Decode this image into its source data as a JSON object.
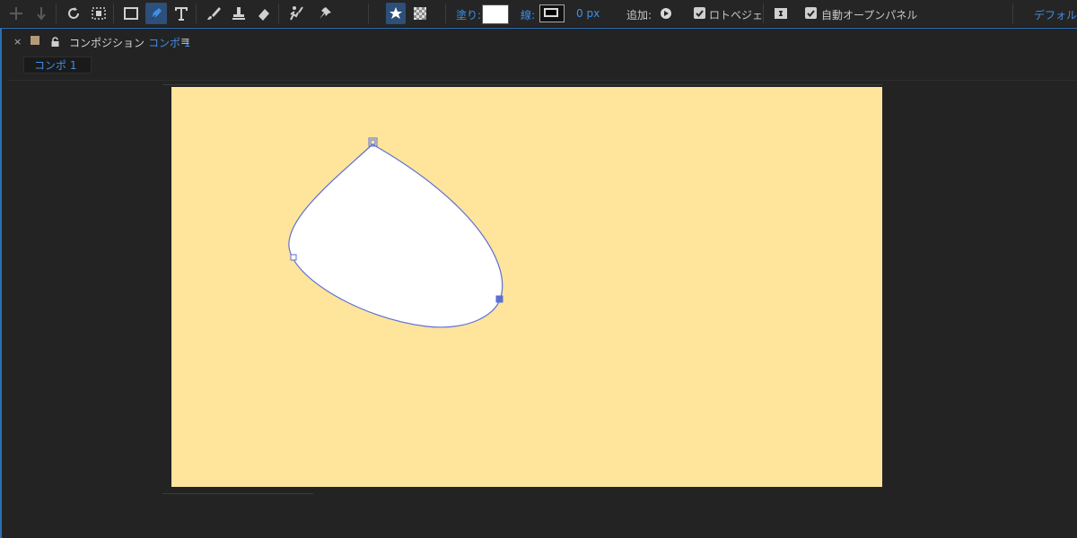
{
  "toolbar": {
    "fill_label": "塗り:",
    "stroke_label": "線:",
    "stroke_width": "0 px",
    "add_label": "追加:",
    "rotobezier_label": "ロトベジェ",
    "auto_open_panel_label": "自動オープンパネル",
    "workspace_label": "デフォルト",
    "rotobezier_checked": true,
    "auto_open_panel_checked": true,
    "fill_color": "#ffffff"
  },
  "panel": {
    "close": "×",
    "title_prefix": "コンポジション",
    "comp_name": "コンポ 1",
    "menu": "≡",
    "sub_tab": "コンポ 1",
    "label_color": "#b59a7a"
  },
  "composition": {
    "background_color": "#ffe49c",
    "shape_fill": "#ffffff",
    "path_color": "#5b6fd6"
  }
}
